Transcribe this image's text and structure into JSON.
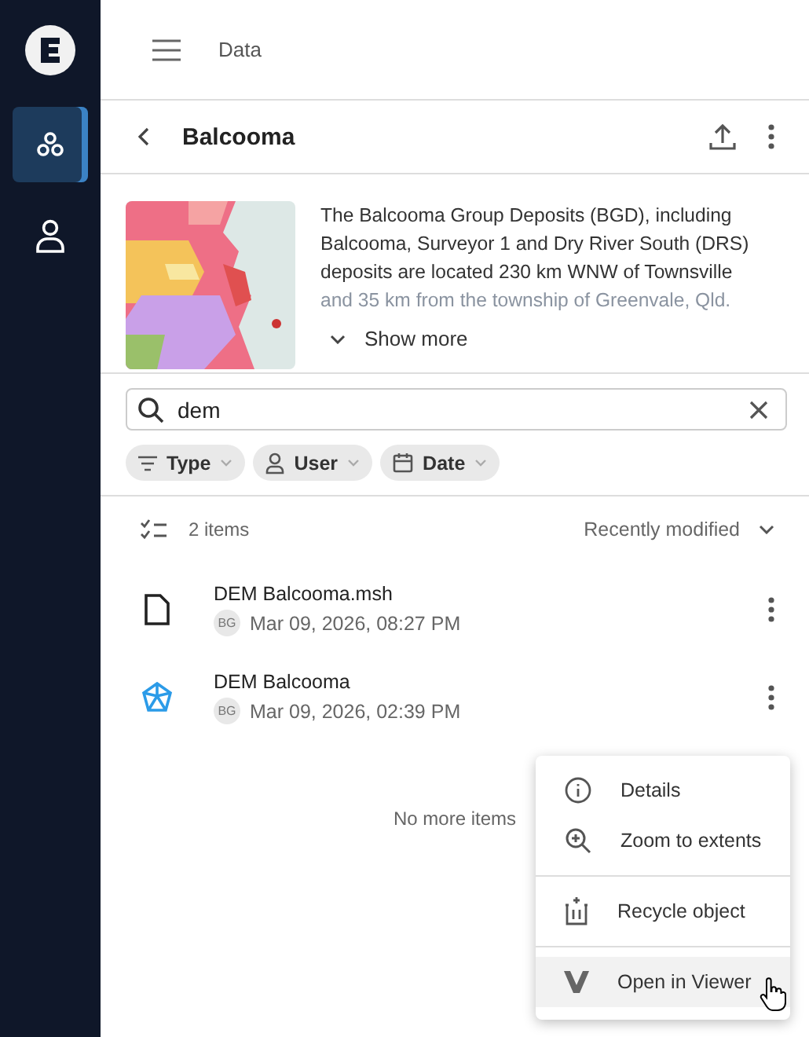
{
  "sidebar": {
    "items": [
      {
        "kind": "data",
        "selected": true
      },
      {
        "kind": "user",
        "selected": false
      }
    ]
  },
  "header": {
    "title": "Data"
  },
  "dataset": {
    "title": "Balcooma",
    "description_lines": [
      "The Balcooma Group Deposits (BGD), including",
      "Balcooma, Surveyor 1 and Dry River South (DRS)",
      "deposits are located 230 km WNW of Townsville",
      "and 35 km from the township of Greenvale, Qld."
    ],
    "show_more": "Show more",
    "expanded": false
  },
  "search": {
    "value": "dem"
  },
  "filters": [
    {
      "kind": "type",
      "label": "Type"
    },
    {
      "kind": "user",
      "label": "User"
    },
    {
      "kind": "date",
      "label": "Date"
    }
  ],
  "list": {
    "count": "2 items",
    "sort": "Recently modified",
    "end_note": "No more items",
    "items": [
      {
        "kind": "file",
        "name": "DEM Balcooma.msh",
        "initials": "BG",
        "date": "Mar 09, 2026, 08:27 PM"
      },
      {
        "kind": "mesh",
        "name": "DEM Balcooma",
        "initials": "BG",
        "date": "Mar 09, 2026, 02:39 PM"
      }
    ]
  },
  "context_menu": {
    "items": [
      {
        "kind": "info",
        "label": "Details",
        "hovered": false,
        "divider_before": false
      },
      {
        "kind": "zoom",
        "label": "Zoom to extents",
        "hovered": false,
        "divider_before": false
      },
      {
        "kind": "recycle",
        "label": "Recycle object",
        "hovered": false,
        "divider_before": true
      },
      {
        "kind": "viewer",
        "label": "Open in Viewer",
        "hovered": true,
        "divider_before": true
      }
    ]
  }
}
